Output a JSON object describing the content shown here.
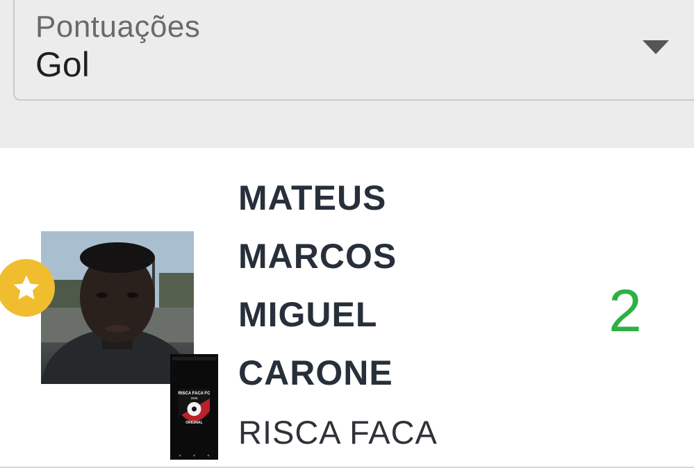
{
  "select": {
    "label": "Pontuações",
    "value": "Gol"
  },
  "player": {
    "name_lines": [
      "MATEUS",
      "MARCOS",
      "MIGUEL",
      "CARONE"
    ],
    "team": "RISCA FACA",
    "score": "2",
    "badge_icon": "star-icon"
  },
  "team_logo": {
    "line1": "RISCA FACA FC",
    "line2": "2025",
    "line3": "ORIGINAL"
  },
  "colors": {
    "score": "#2db045",
    "badge": "#f0bd2e",
    "name": "#27303a"
  }
}
